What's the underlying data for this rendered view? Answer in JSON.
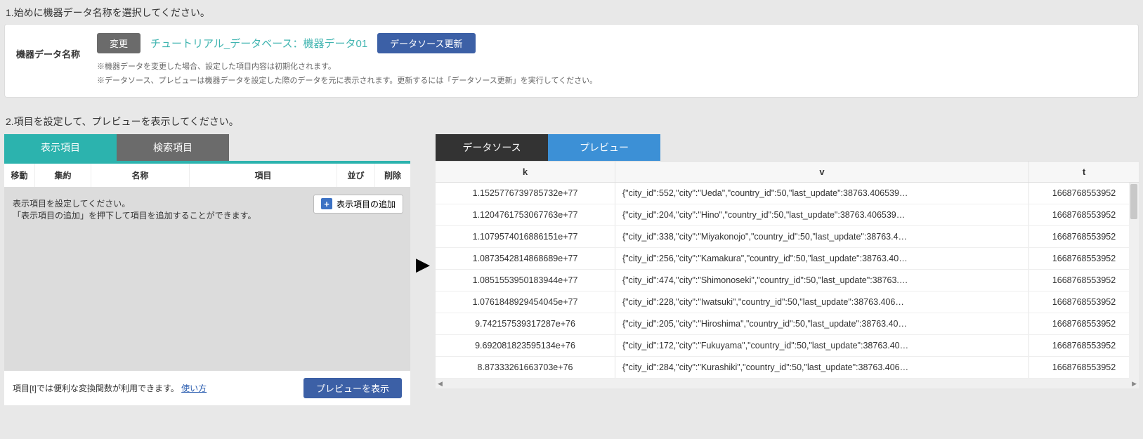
{
  "step1": {
    "title": "1.始めに機器データ名称を選択してください。",
    "label": "機器データ名称",
    "change_btn": "変更",
    "ds_name": "チュートリアル_データベース：機器データ01",
    "update_btn": "データソース更新",
    "note1": "※機器データを変更した場合、設定した項目内容は初期化されます。",
    "note2": "※データソース、プレビューは機器データを設定した際のデータを元に表示されます。更新するには「データソース更新」を実行してください。"
  },
  "step2": {
    "title": "2.項目を設定して、プレビューを表示してください。"
  },
  "left": {
    "tab_display": "表示項目",
    "tab_search": "検索項目",
    "head": {
      "move": "移動",
      "agg": "集約",
      "name": "名称",
      "item": "項目",
      "sort": "並び",
      "del": "削除"
    },
    "placeholder1": "表示項目を設定してください。",
    "placeholder2": "「表示項目の追加」を押下して項目を追加することができます。",
    "add_btn": "表示項目の追加",
    "footer_text": "項目[t]では便利な変換関数が利用できます。",
    "footer_link": "使い方",
    "preview_btn": "プレビューを表示"
  },
  "right": {
    "tab_source": "データソース",
    "tab_preview": "プレビュー",
    "head": {
      "k": "k",
      "v": "v",
      "t": "t"
    },
    "rows": [
      {
        "k": "1.1525776739785732e+77",
        "v": "{\"city_id\":552,\"city\":\"Ueda\",\"country_id\":50,\"last_update\":38763.406539…",
        "t": "1668768553952"
      },
      {
        "k": "1.1204761753067763e+77",
        "v": "{\"city_id\":204,\"city\":\"Hino\",\"country_id\":50,\"last_update\":38763.406539…",
        "t": "1668768553952"
      },
      {
        "k": "1.1079574016886151e+77",
        "v": "{\"city_id\":338,\"city\":\"Miyakonojo\",\"country_id\":50,\"last_update\":38763.4…",
        "t": "1668768553952"
      },
      {
        "k": "1.0873542814868689e+77",
        "v": "{\"city_id\":256,\"city\":\"Kamakura\",\"country_id\":50,\"last_update\":38763.40…",
        "t": "1668768553952"
      },
      {
        "k": "1.0851553950183944e+77",
        "v": "{\"city_id\":474,\"city\":\"Shimonoseki\",\"country_id\":50,\"last_update\":38763.…",
        "t": "1668768553952"
      },
      {
        "k": "1.0761848929454045e+77",
        "v": "{\"city_id\":228,\"city\":\"Iwatsuki\",\"country_id\":50,\"last_update\":38763.406…",
        "t": "1668768553952"
      },
      {
        "k": "9.742157539317287e+76",
        "v": "{\"city_id\":205,\"city\":\"Hiroshima\",\"country_id\":50,\"last_update\":38763.40…",
        "t": "1668768553952"
      },
      {
        "k": "9.692081823595134e+76",
        "v": "{\"city_id\":172,\"city\":\"Fukuyama\",\"country_id\":50,\"last_update\":38763.40…",
        "t": "1668768553952"
      },
      {
        "k": "8.87333261663703e+76",
        "v": "{\"city_id\":284,\"city\":\"Kurashiki\",\"country_id\":50,\"last_update\":38763.406…",
        "t": "1668768553952"
      }
    ]
  }
}
